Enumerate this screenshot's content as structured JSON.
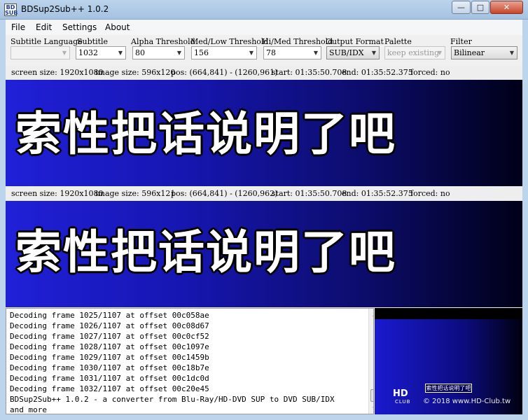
{
  "window": {
    "title": "BDSup2Sub++ 1.0.2",
    "icon_text": "BD SUB",
    "minimize": "—",
    "maximize": "□",
    "close": "✕"
  },
  "menu": [
    "File",
    "Edit",
    "Settings",
    "About"
  ],
  "controls": {
    "subtitle_language": {
      "label": "Subtitle Language",
      "value": ""
    },
    "subtitle": {
      "label": "Subtitle",
      "value": "1032"
    },
    "alpha_threshold": {
      "label": "Alpha Threshold",
      "value": "80"
    },
    "med_low_threshold": {
      "label": "Med/Low Threshold",
      "value": "156"
    },
    "hi_med_threshold": {
      "label": "Hi/Med Threshold",
      "value": "78"
    },
    "output_format": {
      "label": "Output Format",
      "value": "SUB/IDX"
    },
    "palette": {
      "label": "Palette",
      "value": "keep existing"
    },
    "filter": {
      "label": "Filter",
      "value": "Bilinear"
    }
  },
  "info_top": {
    "screen_size": "screen size: 1920x1080",
    "image_size": "image size: 596x120",
    "pos": "pos: (664,841) - (1260,961)",
    "start": "start: 01:35:50.708",
    "end": "end: 01:35:52.375",
    "forced": "forced: no"
  },
  "info_bottom": {
    "screen_size": "screen size: 1920x1080",
    "image_size": "image size: 596x121",
    "pos": "pos: (664,841) - (1260,962)",
    "start": "start: 01:35:50.708",
    "end": "end: 01:35:52.375",
    "forced": "forced: no"
  },
  "preview": {
    "source_subtitle": "索性把话说明了吧",
    "target_subtitle": "索性把话说明了吧"
  },
  "log": [
    "Decoding frame 1025/1107 at offset 00c058ae",
    "Decoding frame 1026/1107 at offset 00c08d67",
    "Decoding frame 1027/1107 at offset 00c0cf52",
    "Decoding frame 1028/1107 at offset 00c1097e",
    "Decoding frame 1029/1107 at offset 00c1459b",
    "Decoding frame 1030/1107 at offset 00c18b7e",
    "Decoding frame 1031/1107 at offset 00c1dc0d",
    "Decoding frame 1032/1107 at offset 00c20e45",
    "BDSup2Sub++ 1.0.2 - a converter from Blu-Ray/HD-DVD SUP to DVD SUB/IDX",
    "and more"
  ],
  "thumbnail": {
    "subtitle_box": "索性把话说明了吧",
    "watermark_logo": "HD",
    "watermark_logo_sub": "CLUB",
    "watermark_text": "© 2018 www.HD-Club.tw"
  },
  "icons": {
    "dropdown": "▼",
    "scroll_up": "▲",
    "scroll_down": "▼"
  }
}
